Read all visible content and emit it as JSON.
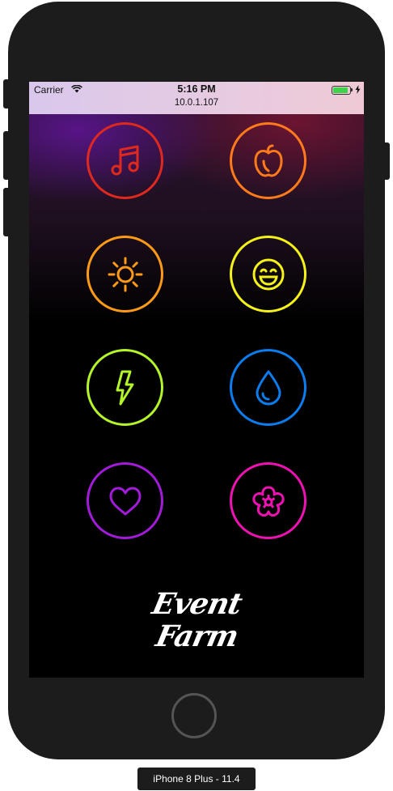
{
  "status_bar": {
    "carrier": "Carrier",
    "time": "5:16 PM",
    "ip_address": "10.0.1.107",
    "battery_color": "#3ed34a"
  },
  "icons": [
    {
      "name": "music-note-icon",
      "color": "#e0291d"
    },
    {
      "name": "apple-icon",
      "color": "#ff7a1a"
    },
    {
      "name": "sun-icon",
      "color": "#ff9a16"
    },
    {
      "name": "smiley-icon",
      "color": "#f5f21a"
    },
    {
      "name": "lightning-icon",
      "color": "#b4f52a"
    },
    {
      "name": "water-drop-icon",
      "color": "#0a7df0"
    },
    {
      "name": "heart-icon",
      "color": "#a21bd8"
    },
    {
      "name": "flower-icon",
      "color": "#ee12b2"
    }
  ],
  "logo": {
    "line1": "Event",
    "line2": "Farm"
  },
  "device_label": "iPhone 8 Plus - 11.4"
}
